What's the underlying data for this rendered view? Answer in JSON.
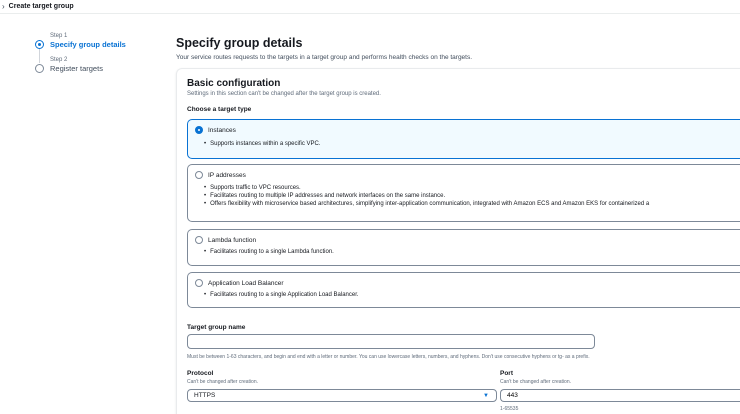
{
  "breadcrumb": {
    "title": "Create target group"
  },
  "steps": [
    {
      "num": "Step 1",
      "title": "Specify group details"
    },
    {
      "num": "Step 2",
      "title": "Register targets"
    }
  ],
  "header": {
    "title": "Specify group details",
    "description": "Your service routes requests to the targets in a target group and performs health checks on the targets."
  },
  "basic": {
    "title": "Basic configuration",
    "description": "Settings in this section can't be changed after the target group is created.",
    "choose_label": "Choose a target type",
    "options": [
      {
        "label": "Instances",
        "bullets": [
          "Supports instances within a specific VPC."
        ]
      },
      {
        "label": "IP addresses",
        "bullets": [
          "Supports traffic to VPC resources.",
          "Facilitates routing to multiple IP addresses and network interfaces on the same instance.",
          "Offers flexibility with microservice based architectures, simplifying inter-application communication, integrated with Amazon ECS and Amazon EKS for containerized a"
        ]
      },
      {
        "label": "Lambda function",
        "bullets": [
          "Facilitates routing to a single Lambda function."
        ]
      },
      {
        "label": "Application Load Balancer",
        "bullets": [
          "Facilitates routing to a single Application Load Balancer."
        ]
      }
    ]
  },
  "target_group_name": {
    "label": "Target group name",
    "value": "",
    "hint": "Must be between 1-63 characters, and begin and end with a letter or number. You can use lowercase letters, numbers, and hyphens. Don't use consecutive hyphens or tg- as a prefix."
  },
  "protocol": {
    "label": "Protocol",
    "hint": "Can't be changed after creation.",
    "value": "HTTPS"
  },
  "port": {
    "label": "Port",
    "hint": "Can't be changed after creation.",
    "value": "443",
    "range": "1-65535"
  }
}
